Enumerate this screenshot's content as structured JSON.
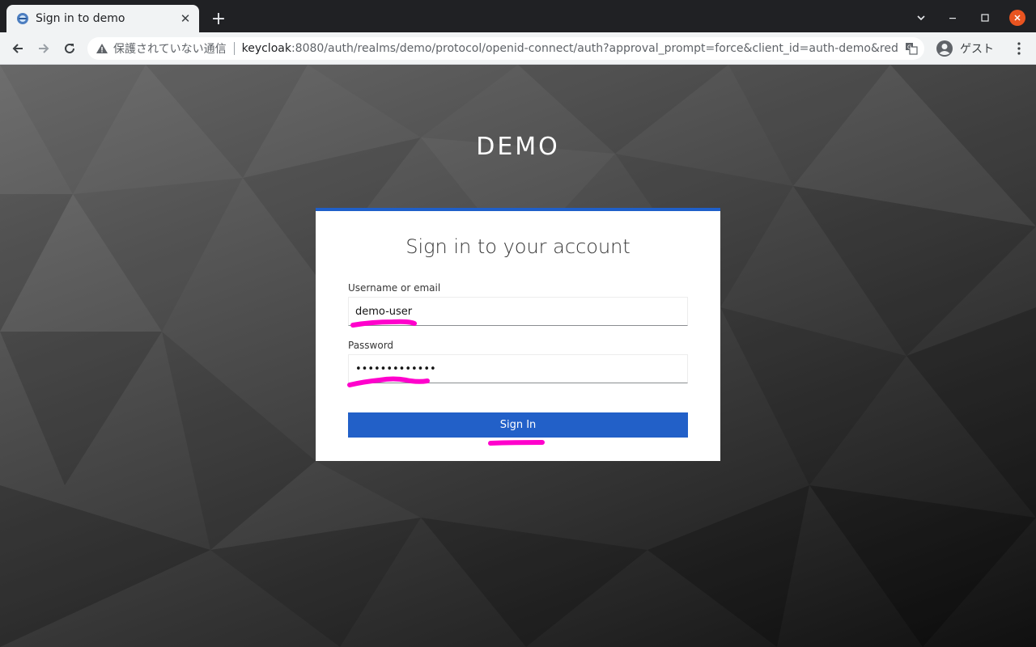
{
  "browser": {
    "tab_title": "Sign in to demo",
    "tab_close": "✕",
    "new_tab": "+",
    "insecure_label": "保護されていない通信",
    "url_host": "keycloak",
    "url_rest": ":8080/auth/realms/demo/protocol/openid-connect/auth?approval_prompt=force&client_id=auth-demo&redirect_uri...",
    "profile_label": "ゲスト"
  },
  "login": {
    "realm_name": "DEMO",
    "title": "Sign in to your account",
    "username_label": "Username or email",
    "username_value": "demo-user",
    "password_label": "Password",
    "password_value": "•••••••••••••",
    "signin_label": "Sign In"
  },
  "colors": {
    "accent": "#1f5fc9",
    "button": "#2260c8",
    "highlight": "#ff00cc"
  }
}
